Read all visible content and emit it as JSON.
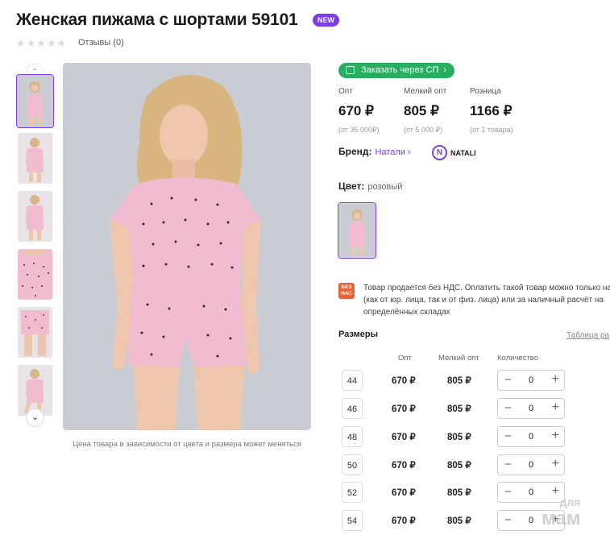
{
  "product": {
    "title": "Женская пижама с шортами 59101",
    "badge": "NEW",
    "rating_stars": 0,
    "reviews_label": "Отзывы (0)",
    "price_note": "Цена товара в зависимости от цвета и размера может меняться"
  },
  "order_button": {
    "label": "Заказать через СП",
    "chevron": "›",
    "icon": "cart-icon"
  },
  "prices": [
    {
      "label": "Опт",
      "value": "670 ₽",
      "sub": "(от 35 000₽)"
    },
    {
      "label": "Мелкий опт",
      "value": "805 ₽",
      "sub": "(от 5 000 ₽)"
    },
    {
      "label": "Розница",
      "value": "1166 ₽",
      "sub": "(от 1 товара)"
    }
  ],
  "brand": {
    "label": "Бренд:",
    "link": "Натали",
    "chevron": "›",
    "logo_letter": "N",
    "logo_text": "NATALI"
  },
  "color": {
    "label": "Цвет:",
    "value": "розовый"
  },
  "vat": {
    "icon_text": "БЕЗ НАС",
    "text": "Товар продается без НДС. Оплатить такой товар можно только на (как от юр. лица, так и от физ. лица) или за наличный расчёт на определённых складах"
  },
  "sizes": {
    "title": "Размеры",
    "table_link": "Таблица ра",
    "headers": {
      "wholesale": "Опт",
      "small": "Мелкий опт",
      "qty": "Количество"
    },
    "rows": [
      {
        "size": "44",
        "opt": "670 ₽",
        "small": "805 ₽",
        "qty": "0"
      },
      {
        "size": "46",
        "opt": "670 ₽",
        "small": "805 ₽",
        "qty": "0"
      },
      {
        "size": "48",
        "opt": "670 ₽",
        "small": "805 ₽",
        "qty": "0"
      },
      {
        "size": "50",
        "opt": "670 ₽",
        "small": "805 ₽",
        "qty": "0"
      },
      {
        "size": "52",
        "opt": "670 ₽",
        "small": "805 ₽",
        "qty": "0"
      },
      {
        "size": "54",
        "opt": "670 ₽",
        "small": "805 ₽",
        "qty": "0"
      }
    ],
    "minus": "−",
    "plus": "+"
  },
  "watermark": {
    "line1": "для",
    "line2": "мам"
  },
  "colors": {
    "accent": "#7b3fe4",
    "green": "#27ae60",
    "vat": "#e8623c",
    "pink": "#f2bcd0"
  }
}
